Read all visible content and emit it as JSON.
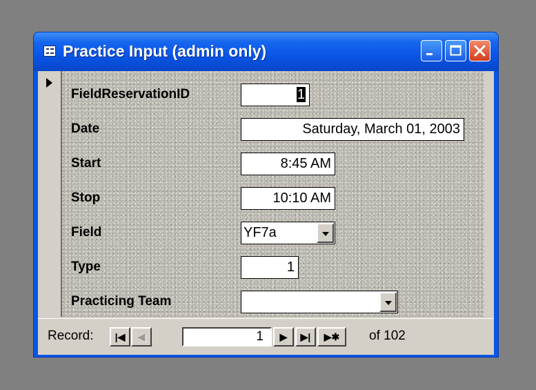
{
  "window": {
    "title": "Practice Input (admin only)",
    "accent": "#0a55e6",
    "close_color": "#d0401f"
  },
  "form": {
    "fields": {
      "field_reservation_id": {
        "label": "FieldReservationID",
        "value": "1"
      },
      "date": {
        "label": "Date",
        "value": "Saturday, March 01, 2003"
      },
      "start": {
        "label": "Start",
        "value": "8:45 AM"
      },
      "stop": {
        "label": "Stop",
        "value": "10:10 AM"
      },
      "field": {
        "label": "Field",
        "value": "YF7a"
      },
      "type": {
        "label": "Type",
        "value": "1"
      },
      "practicing_team": {
        "label": "Practicing Team",
        "value": ""
      }
    }
  },
  "navigation": {
    "record_label": "Record:",
    "current_record": "1",
    "of_label": "of",
    "total_records": "102",
    "buttons": {
      "first": "|◀",
      "prev": "◀",
      "next": "▶",
      "last": "▶|",
      "new": "▶✱"
    }
  }
}
